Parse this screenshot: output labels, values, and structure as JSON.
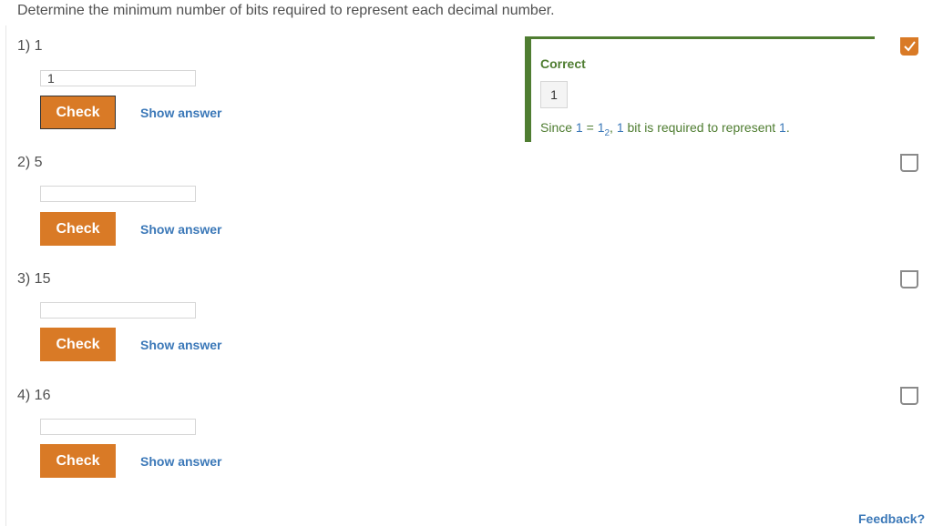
{
  "instructions": "Determine the minimum number of bits required to represent each decimal number.",
  "questions": [
    {
      "label": "1) 1",
      "input_value": "1",
      "check_label": "Check",
      "show_answer_label": "Show answer",
      "completed": true
    },
    {
      "label": "2) 5",
      "input_value": "",
      "check_label": "Check",
      "show_answer_label": "Show answer",
      "completed": false
    },
    {
      "label": "3) 15",
      "input_value": "",
      "check_label": "Check",
      "show_answer_label": "Show answer",
      "completed": false
    },
    {
      "label": "4) 16",
      "input_value": "",
      "check_label": "Check",
      "show_answer_label": "Show answer",
      "completed": false
    }
  ],
  "feedback": {
    "status": "Correct",
    "value": "1",
    "explanation": {
      "prefix": "Since ",
      "n1": "1",
      "eq": " = ",
      "n2": "1",
      "base": "2",
      "comma": ", ",
      "n3": "1",
      "mid": " bit is required to represent ",
      "n4": "1",
      "end": "."
    }
  },
  "feedback_link": "Feedback?",
  "colors": {
    "accent_orange": "#d97a26",
    "correct_green": "#4f7d31",
    "link_blue": "#3b78b8"
  },
  "icons": {
    "completed_checkbox": "checkmark-icon",
    "empty_checkbox": "checkbox-icon"
  }
}
